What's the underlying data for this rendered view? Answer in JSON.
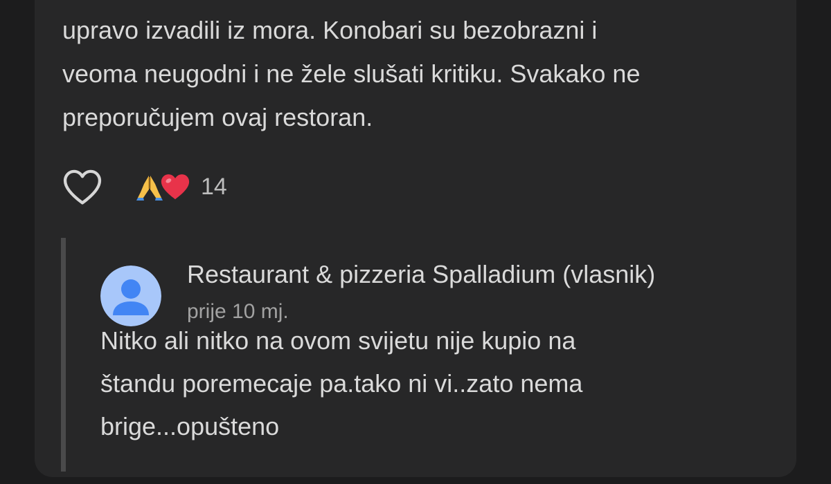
{
  "review": {
    "text_lines": [
      "upravo izvadili iz mora. Konobari su bezobrazni i",
      "veoma neugodni i ne žele slušati kritiku. Svakako ne",
      "preporučujem ovaj restoran."
    ],
    "reactions": {
      "emojis": [
        "🙏",
        "❤️"
      ],
      "count": "14"
    }
  },
  "owner_reply": {
    "name": "Restaurant & pizzeria Spalladium (vlasnik)",
    "time": "prije 10 mj.",
    "text_lines": [
      "Nitko ali nitko na ovom svijetu nije kupio na",
      "štandu poremecaje pa.tako ni vi..zato nema",
      "brige...opušteno"
    ]
  },
  "colors": {
    "background": "#1c1c1d",
    "card": "#272728",
    "text": "#dadada",
    "muted_text": "#a2a2a2",
    "avatar_bg": "#a8c7fa",
    "avatar_fg": "#4285f4"
  },
  "icons": {
    "like": "heart-outline-icon",
    "avatar": "default-user-avatar-icon"
  }
}
